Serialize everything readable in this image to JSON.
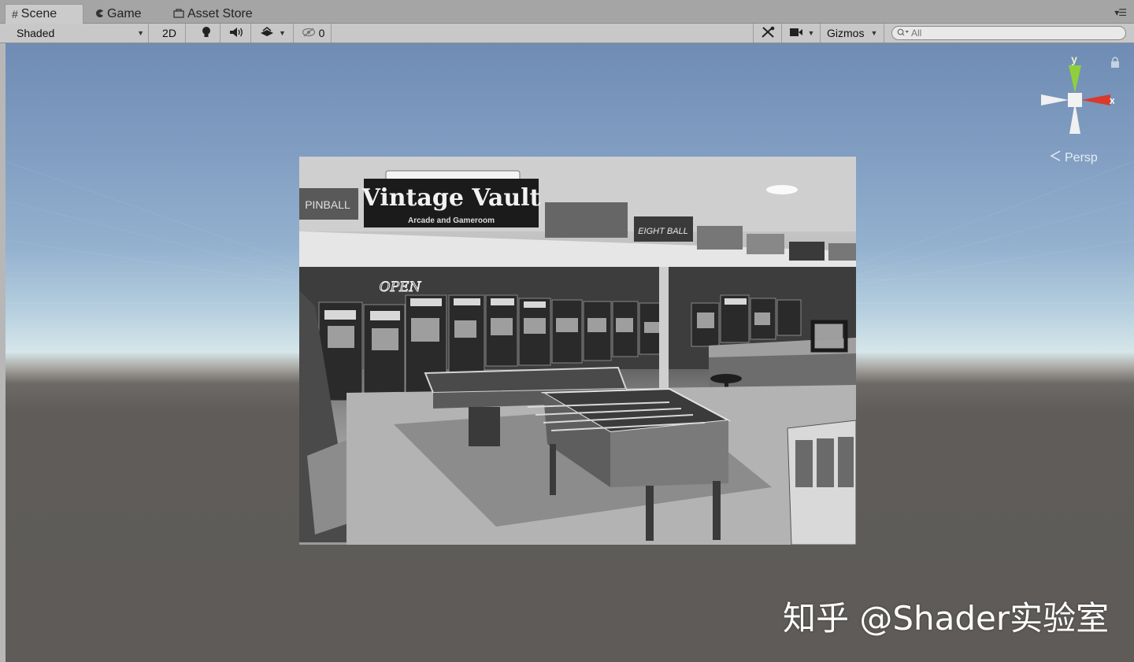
{
  "tabs": [
    {
      "label": "Scene",
      "icon": "hash-icon"
    },
    {
      "label": "Game",
      "icon": "pacman-icon"
    },
    {
      "label": "Asset Store",
      "icon": "bag-icon"
    }
  ],
  "toolbar": {
    "draw_mode": "Shaded",
    "mode_2d": "2D",
    "hidden_count": "0",
    "gizmos_label": "Gizmos",
    "search_placeholder": "All"
  },
  "scene": {
    "image_texts": {
      "sign_title": "Vintage Vault",
      "sign_subtitle": "Arcade and Gameroom",
      "sign_open": "OPEN",
      "sign_eightball": "EIGHT BALL",
      "sign_left": "PINBALL"
    }
  },
  "gizmo": {
    "axis_y": "y",
    "axis_x": "x",
    "projection": "Persp"
  },
  "watermark": "知乎 @Shader实验室",
  "colors": {
    "tab_bar": "#a5a5a5",
    "toolbar": "#c8c8c8",
    "sky_top": "#6f8cb4",
    "horizon": "#d6e6ea",
    "ground": "#5e5b58",
    "axis_x": "#d93a2c",
    "axis_y": "#8fcf3c"
  }
}
